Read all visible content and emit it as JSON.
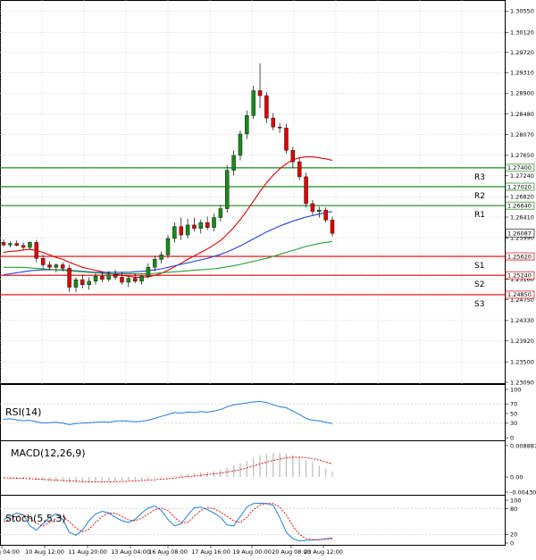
{
  "chart_data": [
    {
      "type": "candlestick",
      "panel": "price",
      "ylim": [
        1.2309,
        1.307
      ],
      "y_ticks": [
        "1.30550",
        "1.30120",
        "1.29720",
        "1.29310",
        "1.28900",
        "1.28480",
        "1.28070",
        "1.27650",
        "1.27240",
        "1.26820",
        "1.26410",
        "1.25990",
        "1.25580",
        "1.25160",
        "1.24750",
        "1.24330",
        "1.23920",
        "1.23500",
        "1.23090"
      ],
      "x_ticks": [
        "9 Aug 04:00",
        "10 Aug 12:00",
        "11 Aug 20:00",
        "13 Aug 04:00",
        "16 Aug 08:00",
        "17 Aug 16:00",
        "19 Aug 00:00",
        "20 Aug 08:00",
        "23 Aug 12:00"
      ],
      "candles": [
        {
          "o": 1.259,
          "h": 1.2596,
          "l": 1.2582,
          "c": 1.2585
        },
        {
          "o": 1.2585,
          "h": 1.2592,
          "l": 1.258,
          "c": 1.2588
        },
        {
          "o": 1.2588,
          "h": 1.2594,
          "l": 1.2582,
          "c": 1.2584
        },
        {
          "o": 1.2584,
          "h": 1.259,
          "l": 1.2575,
          "c": 1.258
        },
        {
          "o": 1.258,
          "h": 1.2592,
          "l": 1.2576,
          "c": 1.259
        },
        {
          "o": 1.259,
          "h": 1.2595,
          "l": 1.255,
          "c": 1.2558
        },
        {
          "o": 1.2558,
          "h": 1.2565,
          "l": 1.2538,
          "c": 1.2545
        },
        {
          "o": 1.2545,
          "h": 1.2552,
          "l": 1.2535,
          "c": 1.254
        },
        {
          "o": 1.254,
          "h": 1.2548,
          "l": 1.253,
          "c": 1.2545
        },
        {
          "o": 1.2545,
          "h": 1.255,
          "l": 1.2532,
          "c": 1.2538
        },
        {
          "o": 1.2538,
          "h": 1.2545,
          "l": 1.249,
          "c": 1.25
        },
        {
          "o": 1.25,
          "h": 1.252,
          "l": 1.249,
          "c": 1.2515
        },
        {
          "o": 1.2515,
          "h": 1.2525,
          "l": 1.2498,
          "c": 1.2505
        },
        {
          "o": 1.2505,
          "h": 1.252,
          "l": 1.2495,
          "c": 1.2512
        },
        {
          "o": 1.2512,
          "h": 1.2528,
          "l": 1.2505,
          "c": 1.2522
        },
        {
          "o": 1.2522,
          "h": 1.253,
          "l": 1.251,
          "c": 1.2516
        },
        {
          "o": 1.2516,
          "h": 1.2532,
          "l": 1.2512,
          "c": 1.2525
        },
        {
          "o": 1.2525,
          "h": 1.2535,
          "l": 1.2515,
          "c": 1.252
        },
        {
          "o": 1.252,
          "h": 1.253,
          "l": 1.2505,
          "c": 1.251
        },
        {
          "o": 1.251,
          "h": 1.2522,
          "l": 1.25,
          "c": 1.2518
        },
        {
          "o": 1.2518,
          "h": 1.2528,
          "l": 1.2508,
          "c": 1.2512
        },
        {
          "o": 1.2512,
          "h": 1.2525,
          "l": 1.2505,
          "c": 1.2522
        },
        {
          "o": 1.2522,
          "h": 1.2548,
          "l": 1.2518,
          "c": 1.254
        },
        {
          "o": 1.254,
          "h": 1.2562,
          "l": 1.2532,
          "c": 1.2556
        },
        {
          "o": 1.2556,
          "h": 1.2572,
          "l": 1.2548,
          "c": 1.2565
        },
        {
          "o": 1.2565,
          "h": 1.2605,
          "l": 1.2558,
          "c": 1.2598
        },
        {
          "o": 1.2598,
          "h": 1.263,
          "l": 1.259,
          "c": 1.2622
        },
        {
          "o": 1.2622,
          "h": 1.264,
          "l": 1.2595,
          "c": 1.2605
        },
        {
          "o": 1.2605,
          "h": 1.2638,
          "l": 1.2598,
          "c": 1.2625
        },
        {
          "o": 1.2625,
          "h": 1.264,
          "l": 1.2612,
          "c": 1.2618
        },
        {
          "o": 1.2618,
          "h": 1.2636,
          "l": 1.2608,
          "c": 1.263
        },
        {
          "o": 1.263,
          "h": 1.2642,
          "l": 1.2615,
          "c": 1.262
        },
        {
          "o": 1.262,
          "h": 1.2648,
          "l": 1.2612,
          "c": 1.264
        },
        {
          "o": 1.264,
          "h": 1.2665,
          "l": 1.2632,
          "c": 1.2658
        },
        {
          "o": 1.2658,
          "h": 1.2745,
          "l": 1.265,
          "c": 1.2735
        },
        {
          "o": 1.2735,
          "h": 1.2775,
          "l": 1.2725,
          "c": 1.2765
        },
        {
          "o": 1.2765,
          "h": 1.2815,
          "l": 1.2755,
          "c": 1.2808
        },
        {
          "o": 1.2808,
          "h": 1.2855,
          "l": 1.2798,
          "c": 1.2845
        },
        {
          "o": 1.2845,
          "h": 1.2905,
          "l": 1.2838,
          "c": 1.2895
        },
        {
          "o": 1.2895,
          "h": 1.295,
          "l": 1.286,
          "c": 1.2885
        },
        {
          "o": 1.2885,
          "h": 1.2892,
          "l": 1.283,
          "c": 1.284
        },
        {
          "o": 1.284,
          "h": 1.285,
          "l": 1.2815,
          "c": 1.2822
        },
        {
          "o": 1.2822,
          "h": 1.283,
          "l": 1.281,
          "c": 1.282
        },
        {
          "o": 1.282,
          "h": 1.2828,
          "l": 1.2768,
          "c": 1.2775
        },
        {
          "o": 1.2775,
          "h": 1.2782,
          "l": 1.274,
          "c": 1.2752
        },
        {
          "o": 1.2752,
          "h": 1.276,
          "l": 1.2715,
          "c": 1.2722
        },
        {
          "o": 1.2722,
          "h": 1.273,
          "l": 1.266,
          "c": 1.2668
        },
        {
          "o": 1.2668,
          "h": 1.2675,
          "l": 1.2645,
          "c": 1.2652
        },
        {
          "o": 1.2652,
          "h": 1.2662,
          "l": 1.264,
          "c": 1.2655
        },
        {
          "o": 1.2655,
          "h": 1.266,
          "l": 1.263,
          "c": 1.2635
        },
        {
          "o": 1.2635,
          "h": 1.2642,
          "l": 1.2602,
          "c": 1.2608
        }
      ],
      "moving_averages": [
        {
          "color": "#e00000",
          "values": [
            1.257,
            1.2572,
            1.2573,
            1.2575,
            1.2576,
            1.2574,
            1.257,
            1.2565,
            1.256,
            1.2556,
            1.255,
            1.2545,
            1.254,
            1.2537,
            1.2534,
            1.2531,
            1.2528,
            1.2526,
            1.2524,
            1.2522,
            1.252,
            1.252,
            1.2521,
            1.2524,
            1.2528,
            1.2534,
            1.2541,
            1.2548,
            1.2556,
            1.2563,
            1.257,
            1.2577,
            1.2585,
            1.2594,
            1.2606,
            1.262,
            1.2636,
            1.2654,
            1.2673,
            1.2692,
            1.271,
            1.2725,
            1.2738,
            1.2748,
            1.2756,
            1.276,
            1.2762,
            1.2762,
            1.276,
            1.2758,
            1.2755
          ]
        },
        {
          "color": "#2040e0",
          "values": [
            1.2525,
            1.2527,
            1.2529,
            1.2531,
            1.2533,
            1.2534,
            1.2535,
            1.2535,
            1.2535,
            1.2535,
            1.2534,
            1.2533,
            1.2532,
            1.2531,
            1.253,
            1.253,
            1.253,
            1.253,
            1.253,
            1.253,
            1.2531,
            1.2532,
            1.2533,
            1.2535,
            1.2537,
            1.254,
            1.2543,
            1.2546,
            1.2549,
            1.2552,
            1.2555,
            1.2558,
            1.2562,
            1.2566,
            1.2571,
            1.2577,
            1.2583,
            1.259,
            1.2597,
            1.2604,
            1.2611,
            1.2617,
            1.2623,
            1.2628,
            1.2633,
            1.2637,
            1.2641,
            1.2644,
            1.2647,
            1.265,
            1.2652
          ]
        },
        {
          "color": "#22a030",
          "values": [
            1.254,
            1.254,
            1.254,
            1.254,
            1.2539,
            1.2538,
            1.2537,
            1.2536,
            1.2535,
            1.2534,
            1.2533,
            1.2532,
            1.2531,
            1.253,
            1.2529,
            1.2528,
            1.2527,
            1.2527,
            1.2527,
            1.2527,
            1.2527,
            1.2527,
            1.2527,
            1.2528,
            1.2529,
            1.253,
            1.2531,
            1.2532,
            1.2533,
            1.2534,
            1.2535,
            1.2536,
            1.2537,
            1.2539,
            1.2541,
            1.2543,
            1.2546,
            1.2549,
            1.2552,
            1.2555,
            1.2558,
            1.2562,
            1.2566,
            1.257,
            1.2574,
            1.2578,
            1.2582,
            1.2585,
            1.2588,
            1.259,
            1.2592
          ]
        }
      ],
      "levels": [
        {
          "name": "R3",
          "value": 1.274,
          "color": "#1a8a1a"
        },
        {
          "name": "R2",
          "value": 1.2702,
          "color": "#1a8a1a"
        },
        {
          "name": "R1",
          "value": 1.2664,
          "color": "#1a8a1a"
        },
        {
          "name": "S1",
          "value": 1.2562,
          "color": "#e00000"
        },
        {
          "name": "S2",
          "value": 1.2524,
          "color": "#e00000"
        },
        {
          "name": "S3",
          "value": 1.2485,
          "color": "#e00000"
        }
      ],
      "level_labels": [
        "1.27400",
        "1.27020",
        "1.26640",
        "1.25620",
        "1.25240",
        "1.24850"
      ],
      "current_price": "1.26087",
      "bull_color": "#1a8a1a",
      "bear_color": "#e00000"
    },
    {
      "type": "line",
      "panel": "rsi",
      "label": "RSI(14)",
      "ylim": [
        0,
        100
      ],
      "y_ticks": [
        "100",
        "70",
        "50",
        "30",
        "0"
      ],
      "color": "#2080e0",
      "values": [
        38,
        39,
        37,
        35,
        36,
        33,
        30,
        31,
        32,
        30,
        27,
        29,
        30,
        31,
        32,
        33,
        32,
        34,
        35,
        34,
        33,
        34,
        36,
        40,
        44,
        48,
        52,
        51,
        53,
        52,
        54,
        53,
        55,
        58,
        64,
        68,
        70,
        72,
        74,
        75,
        73,
        68,
        64,
        62,
        55,
        48,
        40,
        36,
        35,
        32,
        29
      ]
    },
    {
      "type": "bar",
      "panel": "macd",
      "label": "MACD(12,26,9)",
      "ylim": [
        -0.004303,
        0.008887
      ],
      "y_ticks": [
        "0.008887",
        "0.00",
        "-0.004303"
      ],
      "bar_color": "#c0c0c0",
      "signal_color": "#e00000",
      "values": [
        -0.0002,
        -0.0003,
        -0.0004,
        -0.0005,
        -0.0006,
        -0.0008,
        -0.001,
        -0.0011,
        -0.0012,
        -0.0013,
        -0.0015,
        -0.0016,
        -0.0016,
        -0.0016,
        -0.0015,
        -0.0014,
        -0.0013,
        -0.0012,
        -0.0011,
        -0.001,
        -0.0009,
        -0.0008,
        -0.0006,
        -0.0004,
        -0.0002,
        0.0001,
        0.0004,
        0.0006,
        0.0009,
        0.0011,
        0.0013,
        0.0015,
        0.0017,
        0.002,
        0.0026,
        0.0032,
        0.0039,
        0.0046,
        0.0054,
        0.0062,
        0.0066,
        0.0068,
        0.0068,
        0.0066,
        0.0062,
        0.0056,
        0.0048,
        0.004,
        0.0032,
        0.0024,
        0.0016
      ],
      "signal": [
        -0.0003,
        -0.0003,
        -0.0004,
        -0.0004,
        -0.0005,
        -0.0006,
        -0.0007,
        -0.0008,
        -0.0009,
        -0.001,
        -0.0011,
        -0.0012,
        -0.0013,
        -0.0014,
        -0.0014,
        -0.0014,
        -0.0014,
        -0.0013,
        -0.0013,
        -0.0012,
        -0.0011,
        -0.001,
        -0.0009,
        -0.0008,
        -0.0006,
        -0.0005,
        -0.0003,
        -0.0001,
        0.0001,
        0.0003,
        0.0005,
        0.0007,
        0.0009,
        0.0011,
        0.0014,
        0.0017,
        0.0021,
        0.0026,
        0.0031,
        0.0037,
        0.0042,
        0.0047,
        0.0051,
        0.0054,
        0.0056,
        0.0056,
        0.0055,
        0.0052,
        0.0048,
        0.0043,
        0.0037
      ]
    },
    {
      "type": "line",
      "panel": "stoch",
      "label": "Stoch(5,5,3)",
      "ylim": [
        0,
        100
      ],
      "y_ticks": [
        "100",
        "80",
        "20",
        "0"
      ],
      "main_color": "#2080e0",
      "signal_color": "#e00000",
      "main": [
        55,
        62,
        70,
        66,
        40,
        30,
        45,
        60,
        68,
        55,
        25,
        18,
        30,
        52,
        68,
        74,
        70,
        60,
        52,
        48,
        55,
        70,
        82,
        86,
        76,
        55,
        40,
        45,
        65,
        82,
        84,
        78,
        70,
        60,
        42,
        40,
        62,
        84,
        92,
        93,
        92,
        88,
        60,
        25,
        10,
        5,
        6,
        7,
        8,
        10,
        12
      ],
      "signal": [
        50,
        56,
        62,
        66,
        58,
        46,
        40,
        48,
        58,
        62,
        50,
        35,
        26,
        32,
        48,
        62,
        70,
        70,
        62,
        54,
        52,
        58,
        68,
        78,
        82,
        76,
        60,
        48,
        48,
        62,
        76,
        82,
        80,
        72,
        62,
        52,
        48,
        60,
        78,
        88,
        92,
        92,
        84,
        65,
        40,
        20,
        10,
        8,
        8,
        9,
        10
      ]
    }
  ]
}
